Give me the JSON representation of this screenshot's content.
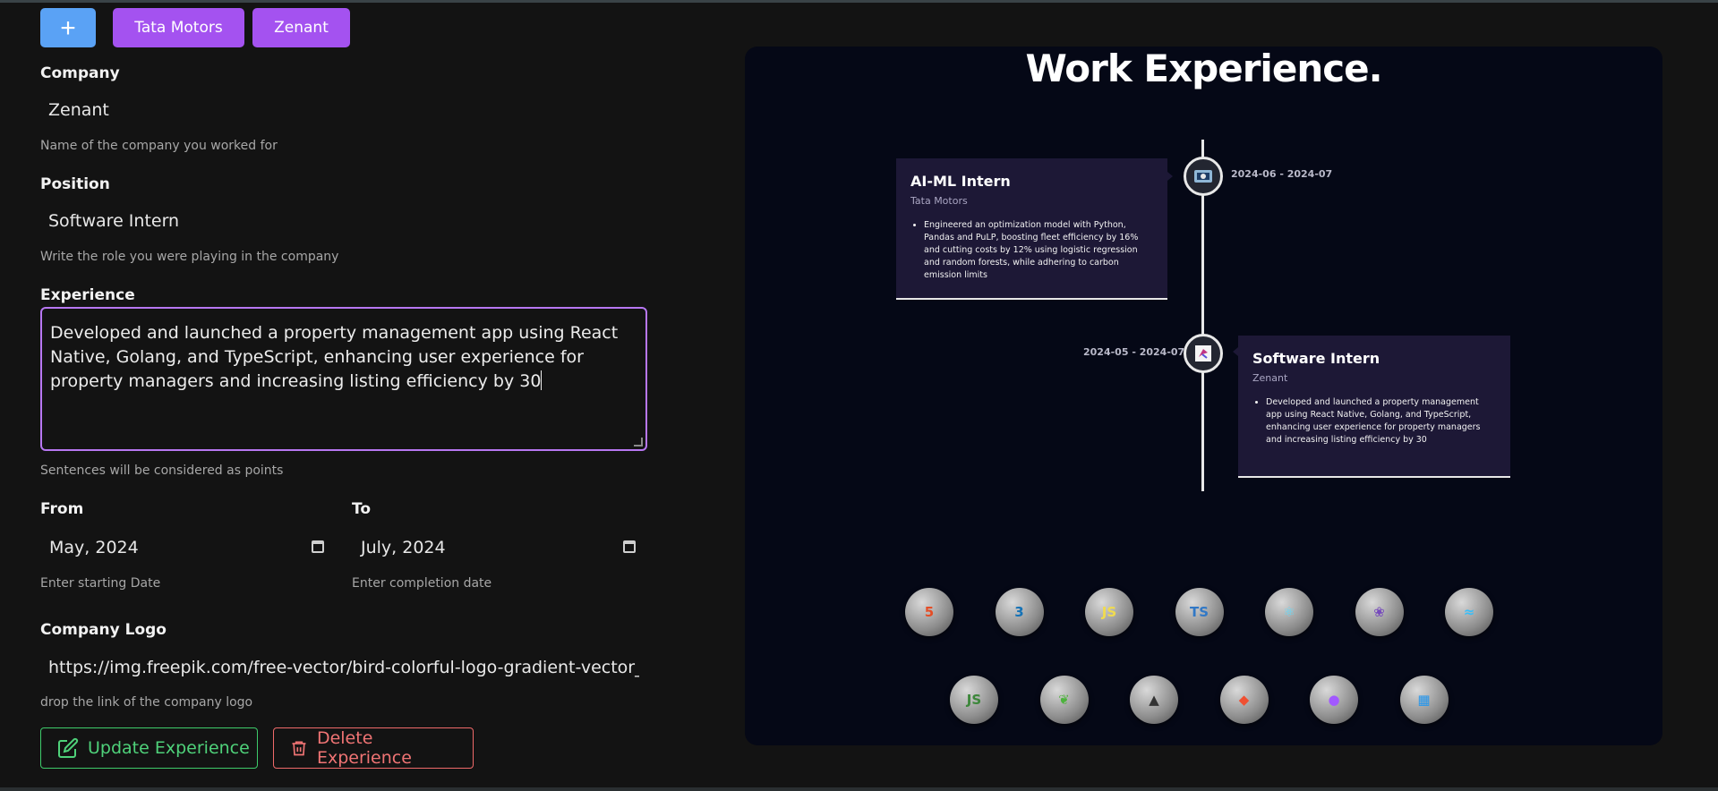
{
  "top_buttons": {
    "add": "+",
    "tabs": [
      "Tata Motors",
      "Zenant"
    ]
  },
  "form": {
    "company": {
      "label": "Company",
      "value": "Zenant",
      "hint": "Name of the company you worked for"
    },
    "position": {
      "label": "Position",
      "value": "Software Intern",
      "hint": "Write the role you were playing in the company"
    },
    "experience": {
      "label": "Experience",
      "value": "Developed and launched a property management app using React Native, Golang, and TypeScript, enhancing user experience for property managers and increasing listing efficiency by 30",
      "hint": "Sentences will be considered as points"
    },
    "from": {
      "label": "From",
      "value": "May, 2024",
      "hint": "Enter starting Date"
    },
    "to": {
      "label": "To",
      "value": "July, 2024",
      "hint": "Enter completion date"
    },
    "logo": {
      "label": "Company Logo",
      "value": "https://img.freepik.com/free-vector/bird-colorful-logo-gradient-vector_",
      "hint": "drop the link of the company logo"
    },
    "update_label": "Update Experience",
    "delete_label": "Delete Experience"
  },
  "preview": {
    "title": "Work Experience.",
    "timeline": [
      {
        "role": "AI-ML Intern",
        "company": "Tata Motors",
        "date": "2024-06 - 2024-07",
        "points": [
          "Engineered an optimization model with Python, Pandas and PuLP, boosting fleet efficiency by 16% and cutting costs by 12% using logistic regression and random forests, while adhering to carbon emission limits"
        ]
      },
      {
        "role": "Software Intern",
        "company": "Zenant",
        "date": "2024-05 - 2024-07",
        "points": [
          "Developed and launched a property management app using React Native, Golang, and TypeScript, enhancing user experience for property managers and increasing listing efficiency by 30"
        ]
      }
    ],
    "tech_icons": [
      {
        "name": "html5-icon",
        "glyph": "5",
        "color": "#e44d26"
      },
      {
        "name": "css3-icon",
        "glyph": "3",
        "color": "#1572b6"
      },
      {
        "name": "javascript-icon",
        "glyph": "JS",
        "color": "#f0db4f"
      },
      {
        "name": "typescript-icon",
        "glyph": "TS",
        "color": "#3178c6"
      },
      {
        "name": "react-icon",
        "glyph": "⚛",
        "color": "#61dafb"
      },
      {
        "name": "redux-icon",
        "glyph": "❀",
        "color": "#764abc"
      },
      {
        "name": "tailwind-icon",
        "glyph": "≈",
        "color": "#38bdf8"
      },
      {
        "name": "nodejs-icon",
        "glyph": "JS",
        "color": "#3c873a"
      },
      {
        "name": "mongodb-icon",
        "glyph": "❦",
        "color": "#4db33d"
      },
      {
        "name": "threejs-icon",
        "glyph": "▲",
        "color": "#333333"
      },
      {
        "name": "git-icon",
        "glyph": "◆",
        "color": "#f05032"
      },
      {
        "name": "figma-icon",
        "glyph": "●",
        "color": "#a259ff"
      },
      {
        "name": "docker-icon",
        "glyph": "▦",
        "color": "#2496ed"
      }
    ]
  }
}
